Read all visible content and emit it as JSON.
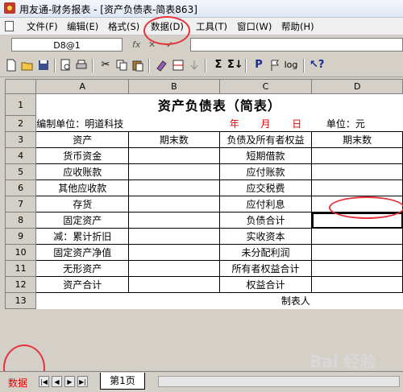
{
  "window": {
    "title": "用友通-财务报表 - [资产负债表-简表863]"
  },
  "menu": [
    "文件(F)",
    "编辑(E)",
    "格式(S)",
    "数据(D)",
    "工具(T)",
    "窗口(W)",
    "帮助(H)"
  ],
  "formula_bar": {
    "cell_ref": "D8@1",
    "fx_label": "fx",
    "cancel": "✕",
    "confirm": "✓",
    "formula": ""
  },
  "columns": [
    "A",
    "B",
    "C",
    "D"
  ],
  "rows": [
    {
      "n": "1"
    },
    {
      "n": "2"
    },
    {
      "n": "3"
    },
    {
      "n": "4"
    },
    {
      "n": "5"
    },
    {
      "n": "6"
    },
    {
      "n": "7"
    },
    {
      "n": "8"
    },
    {
      "n": "9"
    },
    {
      "n": "10"
    },
    {
      "n": "11"
    },
    {
      "n": "12"
    },
    {
      "n": "13"
    }
  ],
  "report": {
    "title": "资产负债表（简表）",
    "unit_label": "编制单位：明道科技",
    "year": "年",
    "month": "月",
    "day": "日",
    "currency": "单位：元",
    "header_assets": "资产",
    "header_period_end_a": "期末数",
    "header_liab": "负债及所有者权益",
    "header_period_end_c": "期末数",
    "assets": [
      "货币资金",
      "应收账款",
      "其他应收款",
      "存货",
      "固定资产",
      "减：累计折旧",
      "固定资产净值",
      "无形资产",
      "资产合计"
    ],
    "liabilities": [
      "短期借款",
      "应付账款",
      "应交税费",
      "应付利息",
      "负债合计",
      "实收资本",
      "未分配利润",
      "所有者权益合计",
      "权益合计"
    ],
    "preparer": "制表人"
  },
  "tabs": {
    "mode_label": "数据",
    "sheet": "第1页"
  },
  "watermark": "Bai 经验"
}
